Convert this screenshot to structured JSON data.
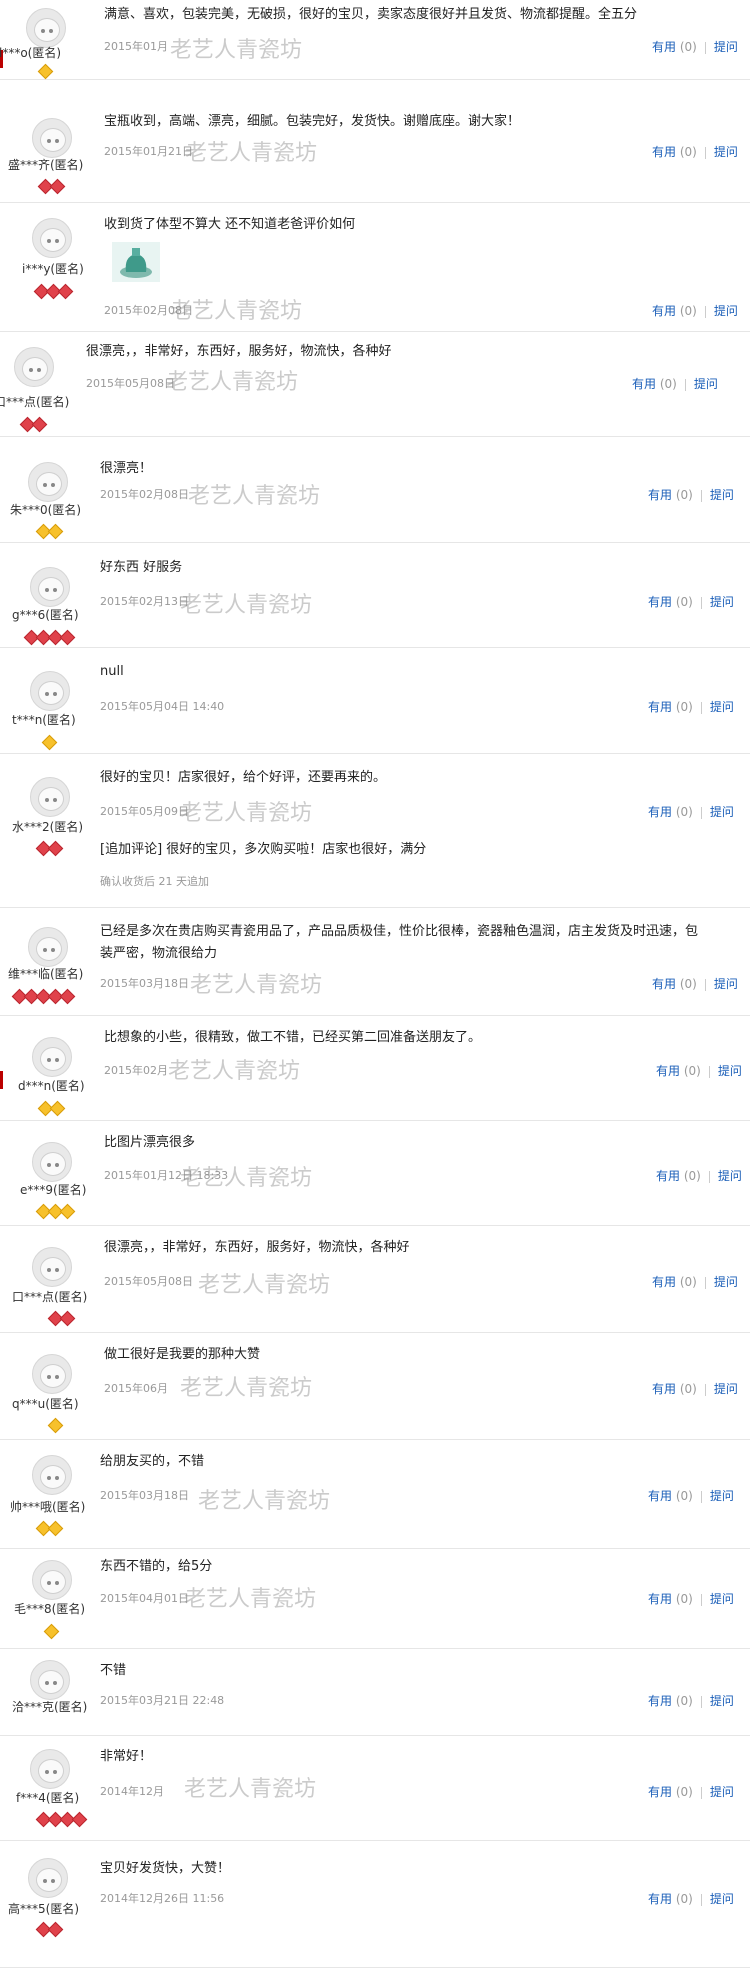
{
  "watermark": "老艺人青瓷坊",
  "action": {
    "useful": "有用",
    "count": "(0)",
    "ask": "提问"
  },
  "reviews": [
    {
      "user": "l***o(匿名)",
      "text": "满意、喜欢，包装完美，无破损，很好的宝贝，卖家态度很好并且发货、物流都提醒。全五分",
      "date": "2015年01月",
      "badge": "gold",
      "badge_count": 1
    },
    {
      "user": "盛***齐(匿名)",
      "text": "宝瓶收到，高端、漂亮，细腻。包装完好，发货快。谢赠底座。谢大家！",
      "date": "2015年01月21日",
      "badge": "red",
      "badge_count": 2
    },
    {
      "user": "i***y(匿名)",
      "text": "收到货了体型不算大 还不知道老爸评价如何",
      "date": "2015年02月08日",
      "badge": "red",
      "badge_count": 3
    },
    {
      "user": "口***点(匿名)",
      "text": "很漂亮，，非常好，东西好，服务好，物流快，各种好",
      "date": "2015年05月08日",
      "badge": "red",
      "badge_count": 2
    },
    {
      "user": "朱***0(匿名)",
      "text": "很漂亮！",
      "date": "2015年02月08日",
      "badge": "gold",
      "badge_count": 2
    },
    {
      "user": "g***6(匿名)",
      "text": "好东西 好服务",
      "date": "2015年02月13日",
      "badge": "red",
      "badge_count": 4
    },
    {
      "user": "t***n(匿名)",
      "text": "null",
      "date": "2015年05月04日 14:40",
      "badge": "gold",
      "badge_count": 1
    },
    {
      "user": "水***2(匿名)",
      "text": "很好的宝贝！店家很好，给个好评，还要再来的。",
      "date": "2015年05月09日",
      "badge": "red",
      "badge_count": 2,
      "append": "[追加评论] 很好的宝贝，多次购买啦！店家也很好，满分",
      "append_note": "确认收货后 21 天追加"
    },
    {
      "user": "维***临(匿名)",
      "text": "已经是多次在贵店购买青瓷用品了，产品品质极佳，性价比很棒，瓷器釉色温润，店主发货及时迅速，包装严密，物流很给力",
      "date": "2015年03月18日",
      "badge": "red",
      "badge_count": 5
    },
    {
      "user": "d***n(匿名)",
      "text": "比想象的小些，很精致，做工不错，已经买第二回准备送朋友了。",
      "date": "2015年02月",
      "badge": "gold",
      "badge_count": 2
    },
    {
      "user": "e***9(匿名)",
      "text": "比图片漂亮很多",
      "date": "2015年01月12日 18:33",
      "badge": "gold",
      "badge_count": 3
    },
    {
      "user": "口***点(匿名)",
      "text": "很漂亮，，非常好，东西好，服务好，物流快，各种好",
      "date": "2015年05月08日",
      "badge": "red",
      "badge_count": 2
    },
    {
      "user": "q***u(匿名)",
      "text": "做工很好是我要的那种大赞",
      "date": "2015年06月",
      "badge": "gold",
      "badge_count": 1
    },
    {
      "user": "帅***哦(匿名)",
      "text": "给朋友买的，不错",
      "date": "2015年03月18日",
      "badge": "gold",
      "badge_count": 2
    },
    {
      "user": "毛***8(匿名)",
      "text": "东西不错的，给5分",
      "date": "2015年04月01日",
      "badge": "gold",
      "badge_count": 1
    },
    {
      "user": "洽***克(匿名)",
      "text": "不错",
      "date": "2015年03月21日 22:48",
      "badge": "none",
      "badge_count": 0
    },
    {
      "user": "f***4(匿名)",
      "text": "非常好！",
      "date": "2014年12月",
      "badge": "red",
      "badge_count": 4
    },
    {
      "user": "高***5(匿名)",
      "text": "宝贝好发货快，大赞！",
      "date": "2014年12月26日 11:56",
      "badge": "red",
      "badge_count": 2
    }
  ]
}
